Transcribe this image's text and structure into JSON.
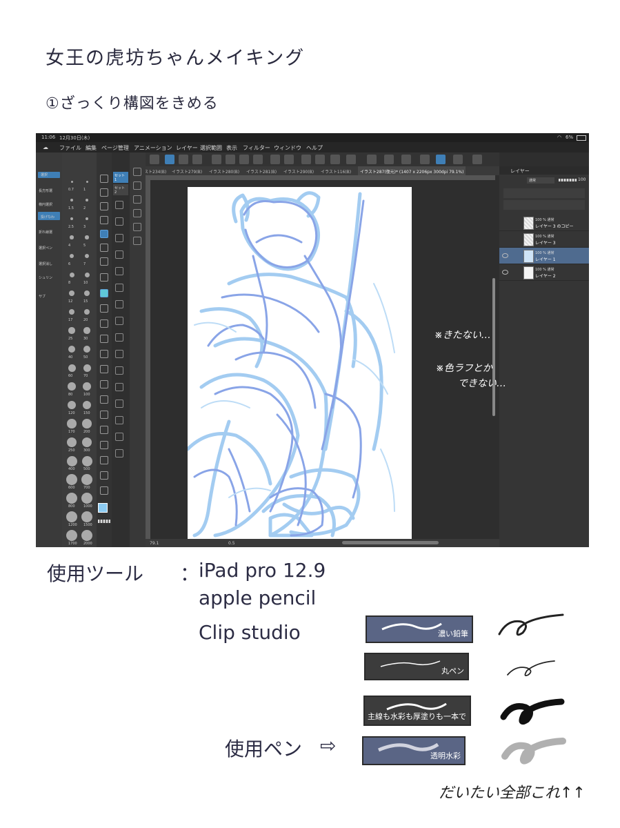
{
  "page": {
    "title": "女王の虎坊ちゃんメイキング",
    "step": "①ざっくり構図をきめる"
  },
  "app": {
    "status": {
      "time": "11:06",
      "date": "12月30日(木)",
      "battery": "6%"
    },
    "menu": [
      "ファイル",
      "編集",
      "ページ管理",
      "アニメーション",
      "レイヤー",
      "選択範囲",
      "表示",
      "フィルター",
      "ウィンドウ",
      "ヘルプ"
    ],
    "tabs": [
      "スト234(B)",
      "イラスト279(B)",
      "イラスト280(B)",
      "イラスト281(B)",
      "イラスト290(B)",
      "イラスト116(B)",
      "イラスト287(復元)* (1407 x 2206px 300dpi 79.1%)"
    ],
    "left_panel_items": [
      "選択",
      "長方形選",
      "楕円選択",
      "投げなわ",
      "折れ線選",
      "選択ペン",
      "選択消し",
      "シュリン",
      "サブ"
    ],
    "brush_sizes": [
      "0.7",
      "1",
      "1.5",
      "2",
      "2.5",
      "3",
      "4",
      "5",
      "6",
      "7",
      "8",
      "10",
      "12",
      "15",
      "17",
      "20",
      "25",
      "30",
      "40",
      "50",
      "60",
      "70",
      "80",
      "100",
      "120",
      "150",
      "170",
      "200",
      "250",
      "300",
      "400",
      "500",
      "600",
      "700",
      "800",
      "1000",
      "1200",
      "1500",
      "1700",
      "2000"
    ],
    "sub_tool_tabs": [
      "セット1",
      "セット2"
    ],
    "layers_title": "レイヤー",
    "blend_mode": "通常",
    "opacity": "100",
    "layers": [
      {
        "meta": "100 % 通常",
        "name": "レイヤー 3 のコピー",
        "selected": false
      },
      {
        "meta": "100 % 通常",
        "name": "レイヤー 3",
        "selected": false
      },
      {
        "meta": "100 % 通常",
        "name": "レイヤー 1",
        "selected": true
      },
      {
        "meta": "100 % 通常",
        "name": "レイヤー 2",
        "selected": false
      }
    ],
    "zoom": "79.1",
    "brush_readout": "0.5",
    "notes": [
      "※きたない…",
      "※色ラフとか",
      "できない…"
    ]
  },
  "info": {
    "tools_label": "使用ツール",
    "separator": "：",
    "devices": [
      "iPad pro 12.9",
      "apple pencil",
      "Clip studio"
    ],
    "pen_label": "使用ペン",
    "pen_arrow": "⇨",
    "brushes": [
      {
        "name": "濃い鉛筆",
        "style": "blue"
      },
      {
        "name": "丸ペン",
        "style": "dark"
      },
      {
        "name": "主線も水彩も厚塗りも一本で",
        "style": "dark"
      },
      {
        "name": "透明水彩",
        "style": "blue"
      }
    ],
    "footer_note": "だいたい全部これ↑↑"
  },
  "colors": {
    "sketch_light": "#9cc8f0",
    "sketch_dark": "#7f9de6",
    "accent": "#3f7fb6"
  }
}
